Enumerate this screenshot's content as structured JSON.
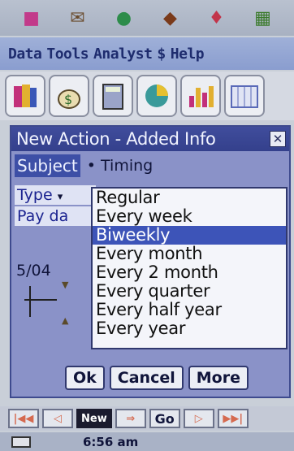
{
  "silk_icons": [
    "people-icon",
    "mail-icon",
    "globe-icon",
    "disk-icon",
    "tag-icon",
    "grid-icon"
  ],
  "menu": {
    "items": [
      "Data",
      "Tools",
      "Analyst",
      "$",
      "Help"
    ]
  },
  "apps": [
    "books-icon",
    "money-bag-icon",
    "calculator-icon",
    "pie-chart-icon",
    "bar-chart-icon",
    "calendar-icon"
  ],
  "dialog": {
    "title": "New Action - Added Info",
    "tab_subject": "Subject",
    "tab_timing": "• Timing",
    "labels": {
      "type": "Type",
      "type_marker": "▾",
      "pay_date": "Pay da"
    },
    "date_fragment": "5/04",
    "options": [
      "Regular",
      "Every week",
      "Biweekly",
      "Every month",
      "Every 2 month",
      "Every quarter",
      "Every half year",
      "Every year"
    ],
    "selected_option": "Biweekly",
    "buttons": {
      "ok": "Ok",
      "cancel": "Cancel",
      "more": "More"
    }
  },
  "nav": {
    "first": "|◀◀",
    "prev": "◁",
    "new": "New",
    "arrow": "⇒",
    "go": "Go",
    "next": "▷",
    "last": "▶▶|"
  },
  "status": {
    "time": "6:56 am"
  },
  "colors": {
    "title_bar": "#3a4694",
    "selection": "#3d54b8",
    "dialog_bg": "#8a92c8"
  }
}
